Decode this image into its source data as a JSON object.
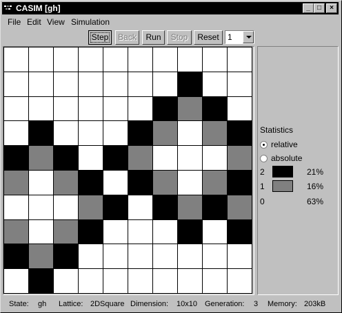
{
  "window": {
    "title": "CASIM [gh]",
    "minimize_glyph": "_",
    "maximize_glyph": "□",
    "close_glyph": "×"
  },
  "menu": [
    "File",
    "Edit",
    "View",
    "Simulation"
  ],
  "toolbar": {
    "step": "Step",
    "back": "Back",
    "run": "Run",
    "stop": "Stop",
    "reset": "Reset",
    "step_count": "1"
  },
  "grid": {
    "rows": [
      [
        0,
        0,
        0,
        0,
        0,
        0,
        0,
        0,
        0,
        0
      ],
      [
        0,
        0,
        0,
        0,
        0,
        0,
        0,
        2,
        0,
        0
      ],
      [
        0,
        0,
        0,
        0,
        0,
        0,
        2,
        1,
        2,
        0
      ],
      [
        0,
        2,
        0,
        0,
        0,
        2,
        1,
        0,
        1,
        2
      ],
      [
        2,
        1,
        2,
        0,
        2,
        1,
        0,
        0,
        0,
        1
      ],
      [
        1,
        0,
        1,
        2,
        0,
        2,
        1,
        0,
        1,
        2
      ],
      [
        0,
        0,
        0,
        1,
        2,
        0,
        2,
        1,
        2,
        1
      ],
      [
        1,
        0,
        1,
        2,
        0,
        0,
        0,
        2,
        0,
        2
      ],
      [
        2,
        1,
        2,
        0,
        0,
        0,
        0,
        0,
        0,
        0
      ],
      [
        0,
        2,
        0,
        0,
        0,
        0,
        0,
        0,
        0,
        0
      ]
    ],
    "colors": {
      "0": "#ffffff",
      "1": "#808080",
      "2": "#000000"
    }
  },
  "statistics": {
    "title": "Statistics",
    "relative_label": "relative",
    "absolute_label": "absolute",
    "selected": "relative",
    "rows": [
      {
        "state": "2",
        "color": "#000000",
        "percent": "21%"
      },
      {
        "state": "1",
        "color": "#808080",
        "percent": "16%"
      },
      {
        "state": "0",
        "color": "#c0c0c0",
        "percent": "63%"
      }
    ]
  },
  "status": {
    "state_label": "State:",
    "state_value": "gh",
    "lattice_label": "Lattice:",
    "lattice_value": "2DSquare",
    "dimension_label": "Dimension:",
    "dimension_value": "10x10",
    "generation_label": "Generation:",
    "generation_value": "3",
    "memory_label": "Memory:",
    "memory_value": "203kB"
  }
}
